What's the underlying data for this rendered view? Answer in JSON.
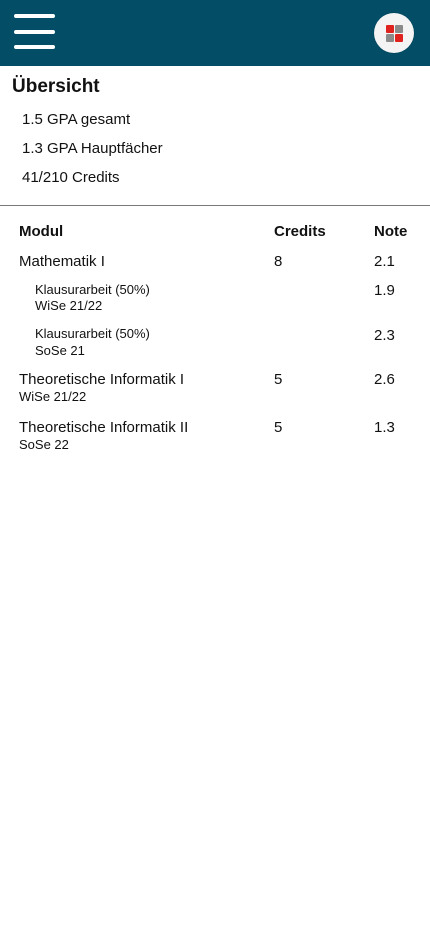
{
  "header": {
    "menu_icon": "hamburger-menu-icon",
    "apps_icon": "apps-grid-icon",
    "apps_colors": [
      "#e0221f",
      "#8a8a8a",
      "#8a8a8a",
      "#e0221f"
    ],
    "brand_color": "#034e66"
  },
  "overview": {
    "title": "Übersicht",
    "stats": [
      "1.5 GPA gesamt",
      "1.3 GPA Hauptfächer",
      "41/210 Credits"
    ]
  },
  "table": {
    "headers": {
      "module": "Modul",
      "credits": "Credits",
      "grade": "Note"
    },
    "rows": [
      {
        "module": "Mathematik I",
        "credits": "8",
        "grade": "2.1"
      },
      {
        "module": "Klausurarbeit (50%)",
        "semester": "WiSe 21/22",
        "grade": "1.9"
      },
      {
        "module": "Klausurarbeit (50%)",
        "semester": "SoSe 21",
        "grade": "2.3"
      },
      {
        "module": "Theoretische Informatik I",
        "semester": "WiSe 21/22",
        "credits": "5",
        "grade": "2.6"
      },
      {
        "module": "Theoretische Informatik II",
        "semester": "SoSe 22",
        "credits": "5",
        "grade": "1.3"
      }
    ]
  }
}
